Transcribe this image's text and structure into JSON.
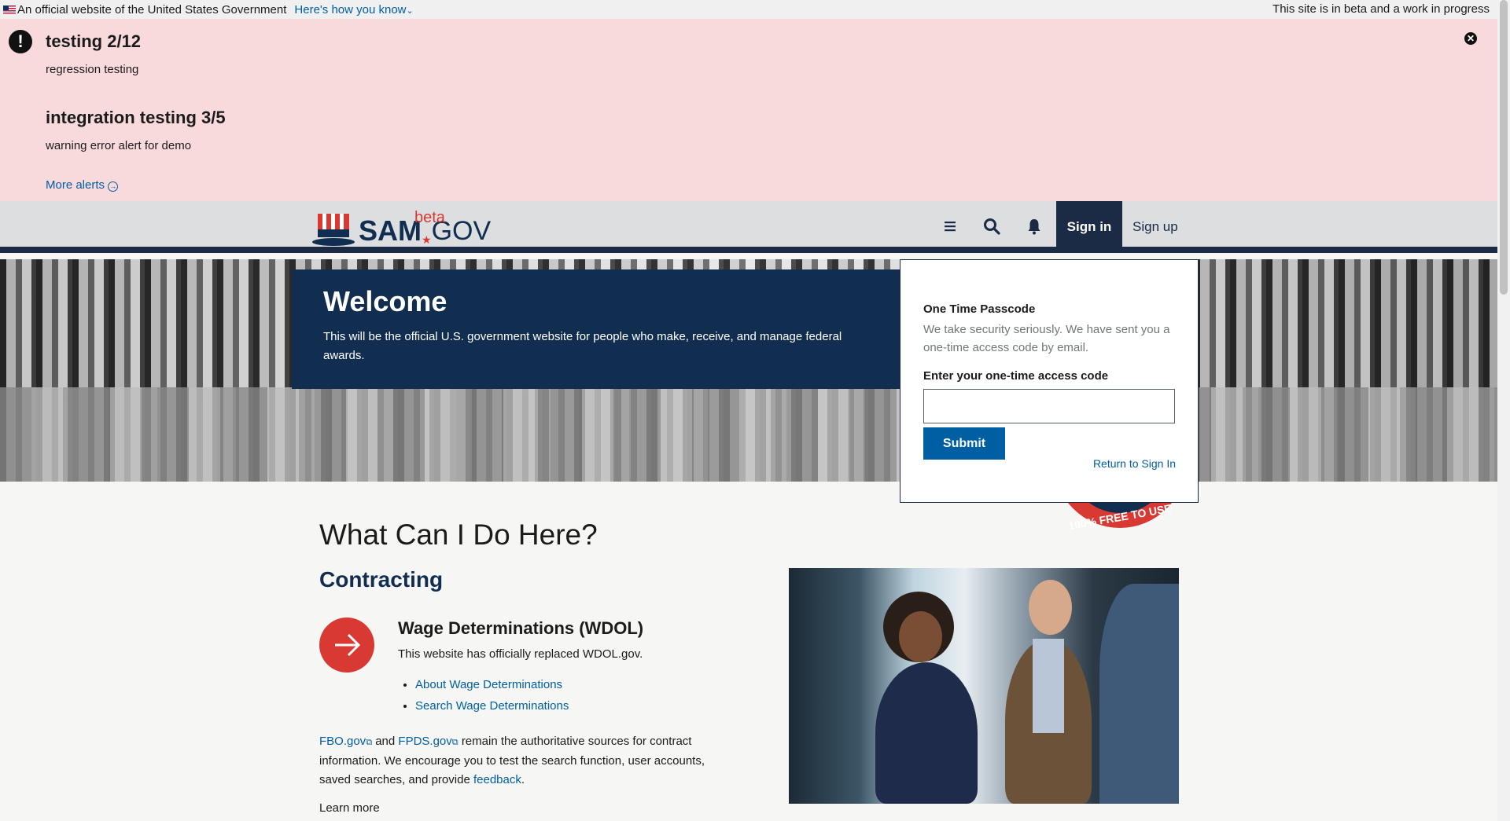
{
  "gov_banner": {
    "official_text": "An official website of the United States Government",
    "how_you_know": "Here's how you know",
    "beta_note": "This site is in beta and a work in progress"
  },
  "alerts": {
    "items": [
      {
        "title": "testing 2/12",
        "body": "regression testing"
      },
      {
        "title": "integration testing 3/5",
        "body": "warning error alert for demo"
      }
    ],
    "more_alerts": "More alerts",
    "close_symbol": "✕"
  },
  "header": {
    "logo_sam": "SAM",
    "logo_gov": "GOV",
    "logo_beta": "beta",
    "menu_icon": "hamburger-icon",
    "search_icon": "search-icon",
    "bell_icon": "bell-icon",
    "sign_in": "Sign in",
    "sign_up": "Sign up"
  },
  "hero": {
    "title": "Welcome",
    "text": "This will be the official U.S. government website for people who make, receive, and manage federal awards."
  },
  "otp": {
    "title": "One Time Passcode",
    "description": "We take security seriously. We have sent you a one-time access code by email.",
    "label": "Enter your one-time access code",
    "input_value": "",
    "submit": "Submit",
    "return_link": "Return to Sign In"
  },
  "seal": {
    "text": "100% FREE TO USE"
  },
  "main": {
    "heading": "What Can I Do Here?",
    "section": "Contracting",
    "wdol": {
      "title": "Wage Determinations (WDOL)",
      "description": "This website has officially replaced WDOL.gov.",
      "links": [
        "About Wage Determinations",
        "Search Wage Determinations"
      ]
    },
    "para": {
      "fbo": "FBO.gov",
      "and": "and",
      "fpds": "FPDS.gov",
      "text1": "remain the authoritative sources for contract information. We encourage you to test the search function, user accounts, saved searches, and provide",
      "feedback": "feedback",
      "period": "."
    },
    "learn_more": "Learn more"
  },
  "colors": {
    "accent_blue": "#005ea2",
    "navy": "#112e51",
    "red": "#d83933",
    "alert_bg": "#f8dadc"
  }
}
